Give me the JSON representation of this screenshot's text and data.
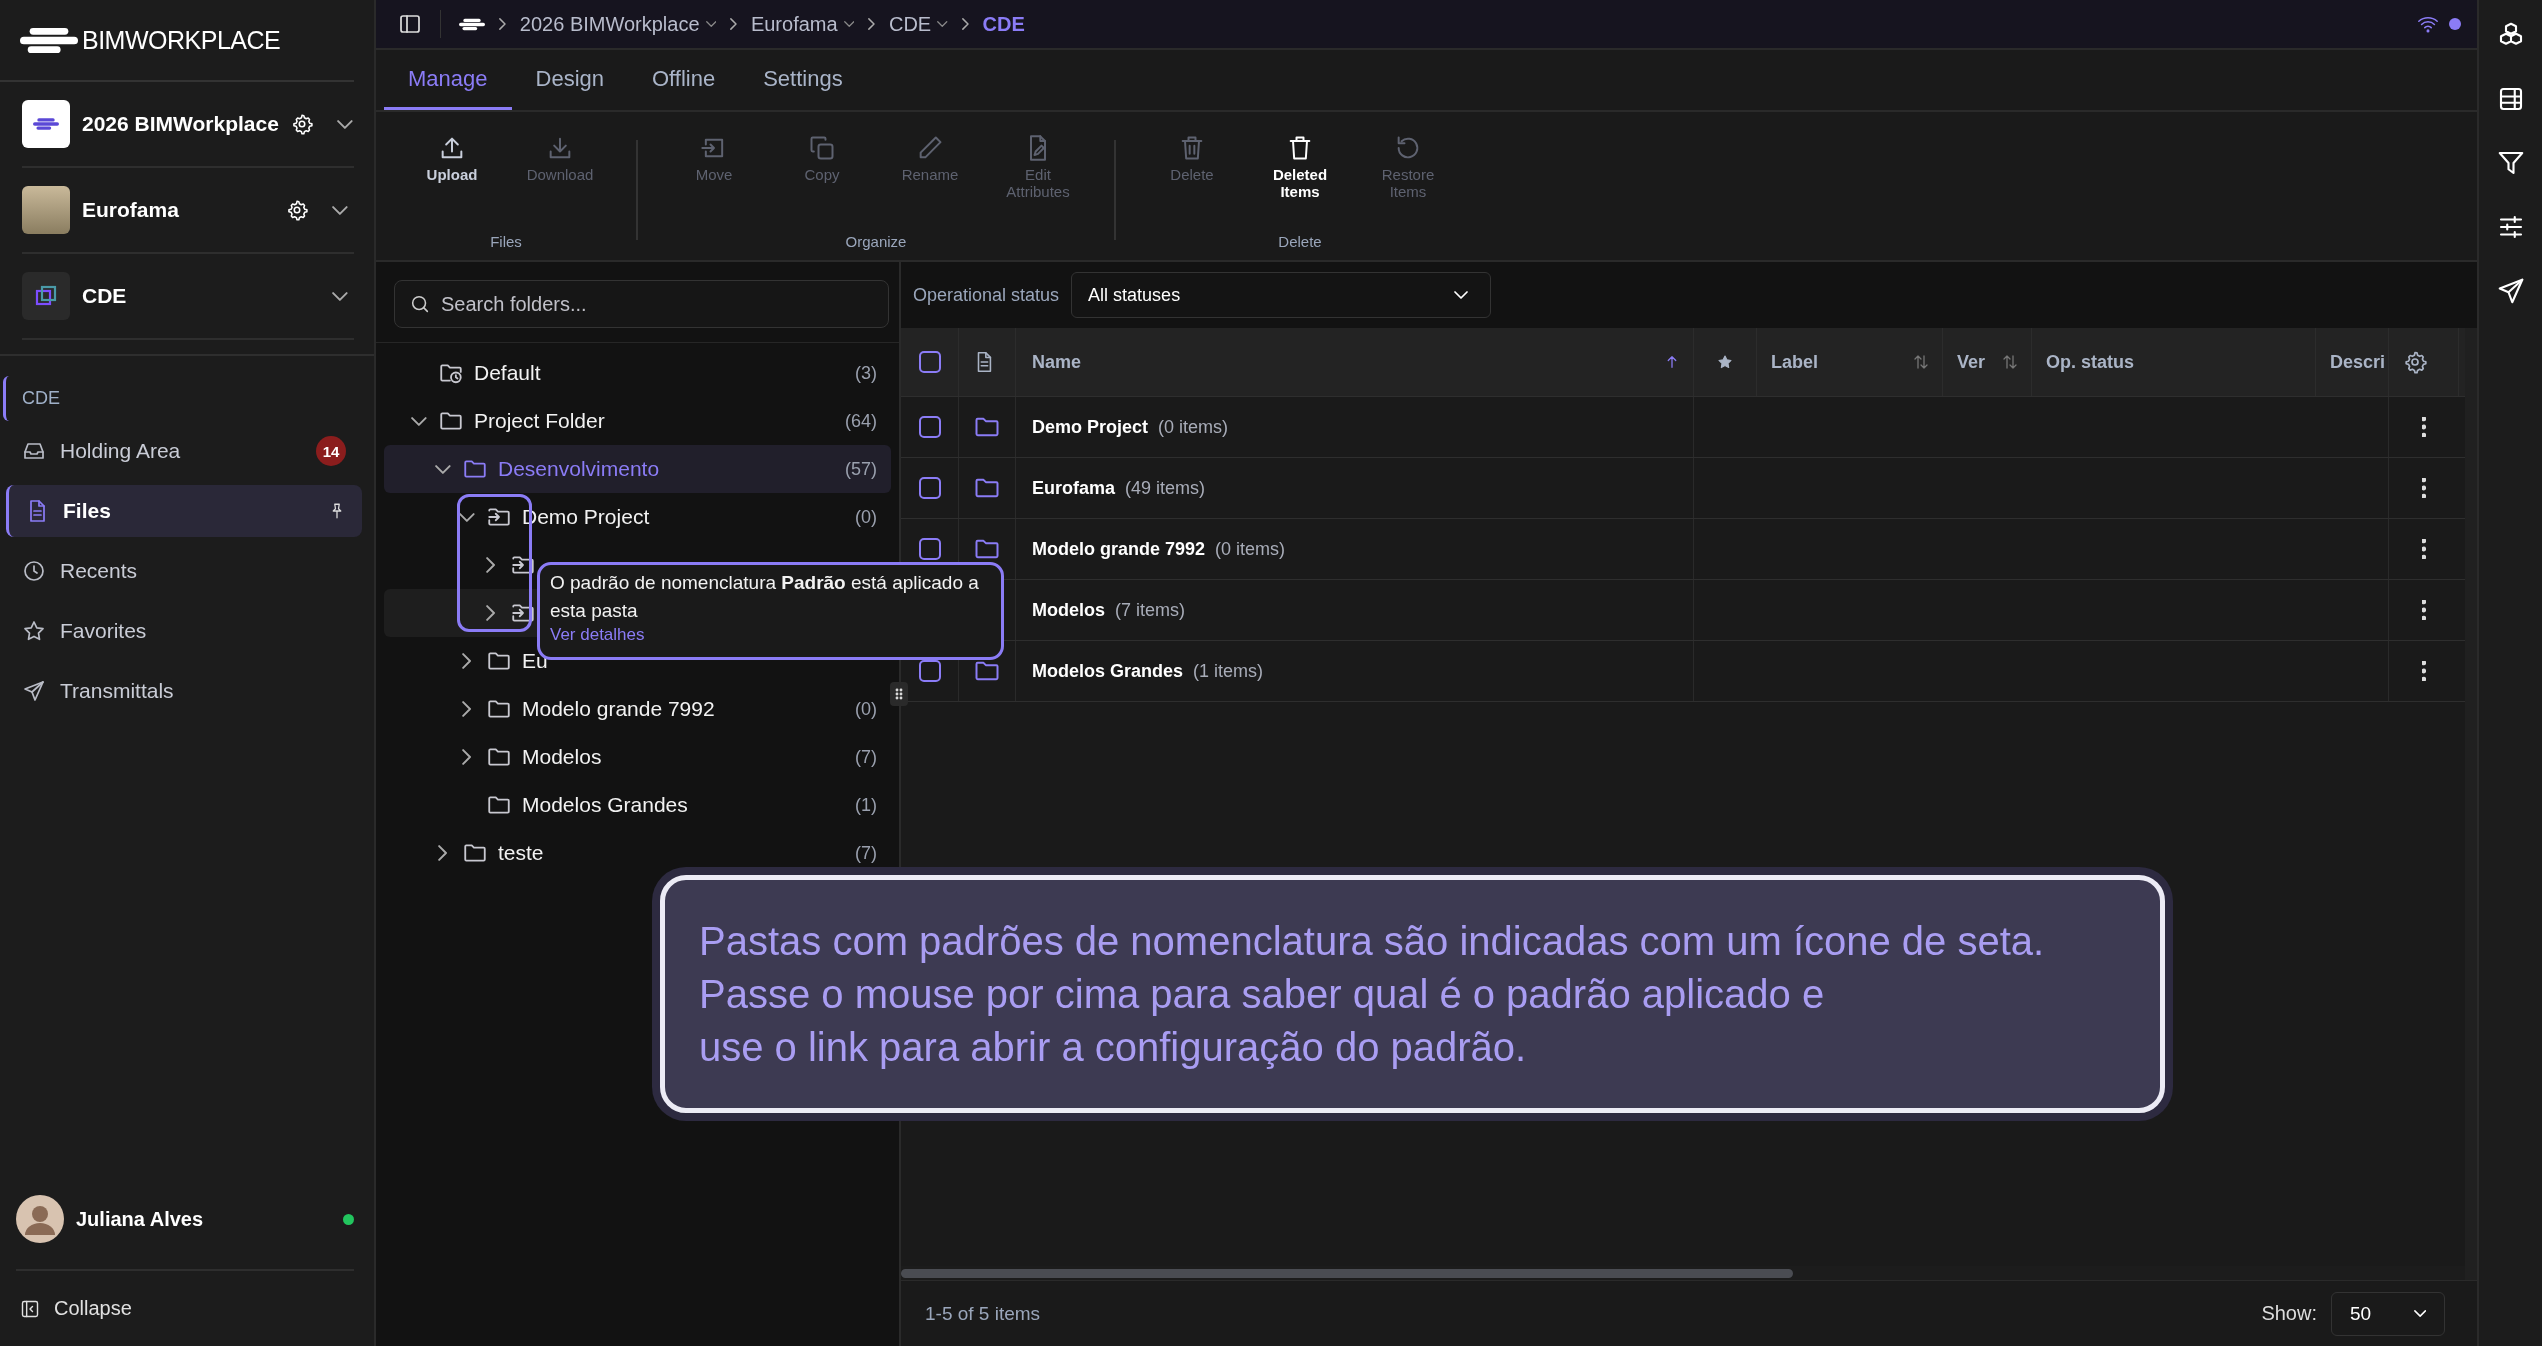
{
  "brand": "BIM**WORKPLACE**",
  "workspaces": [
    {
      "name": "2026 BIMWorkplace",
      "settings": true
    },
    {
      "name": "Eurofama",
      "settings": true
    },
    {
      "name": "CDE",
      "settings": false
    }
  ],
  "nav": {
    "section": "CDE",
    "items": [
      {
        "label": "Holding Area",
        "badge": "14",
        "selected": false,
        "pinned": false
      },
      {
        "label": "Files",
        "selected": true,
        "pinned": true
      },
      {
        "label": "Recents",
        "selected": false,
        "pinned": false
      },
      {
        "label": "Favorites",
        "selected": false,
        "pinned": false
      },
      {
        "label": "Transmittals",
        "selected": false,
        "pinned": false
      }
    ]
  },
  "user": {
    "name": "Juliana Alves",
    "online": true
  },
  "collapse": "Collapse",
  "breadcrumb": [
    {
      "label": "2026 BIMWorkplace",
      "dropdown": true,
      "selected": false
    },
    {
      "label": "Eurofama",
      "dropdown": true,
      "selected": false
    },
    {
      "label": "CDE",
      "dropdown": true,
      "selected": false
    },
    {
      "label": "CDE",
      "dropdown": false,
      "selected": true
    }
  ],
  "tabs": [
    {
      "label": "Manage",
      "selected": true
    },
    {
      "label": "Design",
      "selected": false
    },
    {
      "label": "Offline",
      "selected": false
    },
    {
      "label": "Settings",
      "selected": false
    }
  ],
  "toolbar": [
    {
      "label": "Files",
      "buttons": [
        {
          "label": "Upload",
          "disabled": false
        },
        {
          "label": "Download",
          "disabled": true
        }
      ]
    },
    {
      "label": "Organize",
      "buttons": [
        {
          "label": "Move",
          "disabled": true
        },
        {
          "label": "Copy",
          "disabled": true
        },
        {
          "label": "Rename",
          "disabled": true
        },
        {
          "label": "Edit Attributes",
          "disabled": true
        }
      ]
    },
    {
      "label": "Delete",
      "buttons": [
        {
          "label": "Delete",
          "disabled": true
        },
        {
          "label": "Deleted Items",
          "disabled": false
        },
        {
          "label": "Restore Items",
          "disabled": true
        }
      ]
    }
  ],
  "folder_search": {
    "placeholder": "Search folders..."
  },
  "folder_tree": [
    {
      "name": "Default",
      "count": "(3)",
      "kind": "default",
      "selected": false
    },
    {
      "name": "Project Folder",
      "count": "(64)",
      "kind": "folder",
      "expanded": true,
      "selected": false,
      "children": [
        {
          "name": "Desenvolvimento",
          "count": "(57)",
          "kind": "folder",
          "expanded": true,
          "selected": true,
          "children": [
            {
              "name": "Demo Project",
              "count": "(0)",
              "kind": "pattern",
              "expanded": true,
              "selected": false,
              "children": [
                {
                  "kind": "pattern",
                  "expanded": false,
                  "selected": false,
                  "hovered": false
                },
                {
                  "kind": "pattern",
                  "expanded": false,
                  "selected": false,
                  "hovered": true
                }
              ]
            },
            {
              "name": "Eu",
              "kind": "folder",
              "expanded": false,
              "selected": false
            },
            {
              "name": "Modelo grande 7992",
              "count": "(0)",
              "kind": "folder",
              "expanded": false,
              "selected": false
            },
            {
              "name": "Modelos",
              "count": "(7)",
              "kind": "folder",
              "expanded": false,
              "selected": false
            },
            {
              "name": "Modelos Grandes",
              "count": "(1)",
              "kind": "folder",
              "selected": false
            }
          ]
        },
        {
          "name": "teste",
          "count": "(7)",
          "kind": "folder",
          "expanded": false,
          "selected": false
        }
      ]
    }
  ],
  "tooltip": {
    "text": "O padrão de nomenclatura **Padrão** está aplicado a esta pasta",
    "link": "Ver detalhes"
  },
  "filter": {
    "label": "Operational status",
    "value": "All statuses"
  },
  "table": {
    "all_checked": false,
    "columns": [
      {
        "label": "Name",
        "kind": "sorted"
      },
      {
        "label": "Label",
        "kind": "sortable"
      },
      {
        "label": "Ver",
        "kind": "sortable"
      },
      {
        "label": "Op. status",
        "kind": "plain"
      },
      {
        "label": "Descri",
        "kind": "plain"
      }
    ],
    "rows": [
      {
        "name": "Demo Project",
        "meta": "(0 items)",
        "checked": false
      },
      {
        "name": "Eurofama",
        "meta": "(49 items)",
        "checked": false
      },
      {
        "name": "Modelo grande 7992",
        "meta": "(0 items)",
        "checked": false
      },
      {
        "name": "Modelos",
        "meta": "(7 items)"
      },
      {
        "name": "Modelos Grandes",
        "meta": "(1 items)",
        "checked": false
      }
    ]
  },
  "footer": {
    "range": "1-5 of 5 items",
    "show_label": "Show:",
    "page_size": "50"
  },
  "tutorial": {
    "lines": [
      "Pastas com padrões de nomenclatura são indicadas com um ícone de seta.",
      "Passe o mouse por cima para saber qual é o padrão aplicado e",
      "use o link para abrir a configuração do padrão."
    ]
  }
}
